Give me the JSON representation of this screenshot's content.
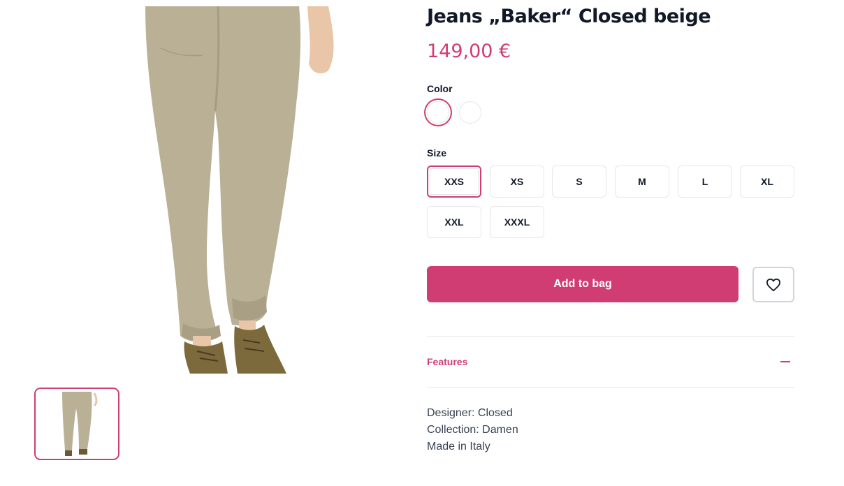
{
  "product": {
    "title": "Jeans „Baker“ Closed beige",
    "price": "149,00 €"
  },
  "colors": {
    "label": "Color",
    "options": [
      {
        "swatch": "#ffffff",
        "selected": true
      },
      {
        "swatch": "#ffffff",
        "selected": false
      }
    ]
  },
  "sizes": {
    "label": "Size",
    "options": [
      "XXS",
      "XS",
      "S",
      "M",
      "L",
      "XL",
      "XXL",
      "XXXL"
    ],
    "selected": "XXS"
  },
  "actions": {
    "add_to_bag": "Add to bag",
    "wishlist_icon": "heart-icon"
  },
  "features": {
    "label": "Features",
    "toggle_icon": "minus-icon",
    "expanded": true,
    "items": [
      "Designer: Closed",
      "Collection: Damen",
      "Made in Italy"
    ]
  },
  "theme": {
    "accent": "#cf3d73",
    "pants": "#b9b096",
    "border": "#e5e7eb"
  }
}
